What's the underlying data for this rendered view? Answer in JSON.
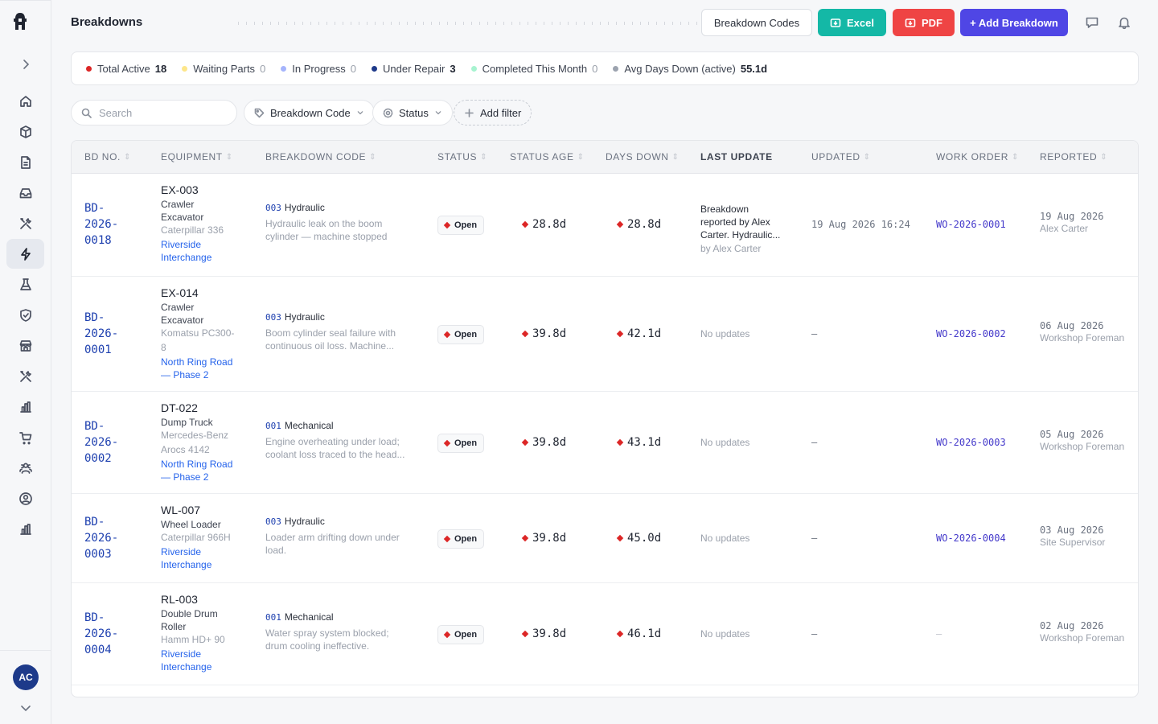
{
  "sidebar": {
    "avatar_initials": "AC",
    "nav": [
      "home-icon",
      "package-icon",
      "file-icon",
      "inbox-icon",
      "tools-icon",
      "bolt-icon",
      "flask-icon",
      "shield-icon",
      "store-icon",
      "tools-icon",
      "bar-chart-icon",
      "cart-icon",
      "users-icon",
      "user-circle-icon",
      "bar-chart-icon"
    ],
    "active_index": 5
  },
  "header": {
    "title": "Breakdowns",
    "codes_label": "Breakdown Codes",
    "excel_label": "Excel",
    "pdf_label": "PDF",
    "add_label": "+ Add Breakdown"
  },
  "stats": [
    {
      "label": "Total Active",
      "value": "18",
      "color": "#dc2626",
      "muted": false
    },
    {
      "label": "Waiting Parts",
      "value": "0",
      "color": "#fde68a",
      "muted": true
    },
    {
      "label": "In Progress",
      "value": "0",
      "color": "#a5b4fc",
      "muted": true
    },
    {
      "label": "Under Repair",
      "value": "3",
      "color": "#1e3a8a",
      "muted": false
    },
    {
      "label": "Completed This Month",
      "value": "0",
      "color": "#a7f3d0",
      "muted": true
    },
    {
      "label": "Avg Days Down (active)",
      "value": "55.1d",
      "color": "#9ca3af",
      "muted": false
    }
  ],
  "filters": {
    "search_placeholder": "Search",
    "code_label": "Breakdown Code",
    "status_label": "Status",
    "add_filter_label": "Add filter"
  },
  "columns": {
    "bd_no": "BD NO.",
    "equipment": "EQUIPMENT",
    "code": "BREAKDOWN CODE",
    "status": "STATUS",
    "status_age": "STATUS AGE",
    "days_down": "DAYS DOWN",
    "last_update": "LAST UPDATE",
    "updated": "UPDATED",
    "work_order": "WORK ORDER",
    "reported": "REPORTED"
  },
  "rows": [
    {
      "bd_lines": [
        "BD-",
        "2026-",
        "0018"
      ],
      "eq_code": "EX-003",
      "eq_type": [
        "Crawler",
        "Excavator"
      ],
      "eq_model": [
        "Caterpillar 336"
      ],
      "eq_loc": [
        "Riverside",
        "Interchange"
      ],
      "code_num": "003",
      "code_name": "Hydraulic",
      "code_desc": [
        "Hydraulic leak on the boom",
        "cylinder — machine stopped"
      ],
      "status": "Open",
      "age": "28.8d",
      "days": "28.8d",
      "last_update": [
        "Breakdown",
        "reported by Alex",
        "Carter. Hydraulic..."
      ],
      "last_update_by": "by Alex Carter",
      "updated": "19 Aug 2026 16:24",
      "work_order": "WO-2026-0001",
      "reported_date": "19 Aug 2026",
      "reported_by": "Alex Carter"
    },
    {
      "bd_lines": [
        "BD-",
        "2026-",
        "0001"
      ],
      "eq_code": "EX-014",
      "eq_type": [
        "Crawler",
        "Excavator"
      ],
      "eq_model": [
        "Komatsu PC300-",
        "8"
      ],
      "eq_loc": [
        "North Ring Road",
        "— Phase 2"
      ],
      "code_num": "003",
      "code_name": "Hydraulic",
      "code_desc": [
        "Boom cylinder seal failure with",
        "continuous oil loss. Machine..."
      ],
      "status": "Open",
      "age": "39.8d",
      "days": "42.1d",
      "last_update": [],
      "last_update_none": "No updates",
      "updated": "—",
      "work_order": "WO-2026-0002",
      "reported_date": "06 Aug 2026",
      "reported_by": "Workshop Foreman"
    },
    {
      "bd_lines": [
        "BD-",
        "2026-",
        "0002"
      ],
      "eq_code": "DT-022",
      "eq_type": [
        "Dump Truck"
      ],
      "eq_model": [
        "Mercedes-Benz",
        "Arocs 4142"
      ],
      "eq_loc": [
        "North Ring Road",
        "— Phase 2"
      ],
      "code_num": "001",
      "code_name": "Mechanical",
      "code_desc": [
        "Engine overheating under load;",
        "coolant loss traced to the head..."
      ],
      "status": "Open",
      "age": "39.8d",
      "days": "43.1d",
      "last_update": [],
      "last_update_none": "No updates",
      "updated": "—",
      "work_order": "WO-2026-0003",
      "reported_date": "05 Aug 2026",
      "reported_by": "Workshop Foreman"
    },
    {
      "bd_lines": [
        "BD-",
        "2026-",
        "0003"
      ],
      "eq_code": "WL-007",
      "eq_type": [
        "Wheel Loader"
      ],
      "eq_model": [
        "Caterpillar 966H"
      ],
      "eq_loc": [
        "Riverside",
        "Interchange"
      ],
      "code_num": "003",
      "code_name": "Hydraulic",
      "code_desc": [
        "Loader arm drifting down under",
        "load."
      ],
      "status": "Open",
      "age": "39.8d",
      "days": "45.0d",
      "last_update": [],
      "last_update_none": "No updates",
      "updated": "—",
      "work_order": "WO-2026-0004",
      "reported_date": "03 Aug 2026",
      "reported_by": "Site Supervisor"
    },
    {
      "bd_lines": [
        "BD-",
        "2026-",
        "0004"
      ],
      "eq_code": "RL-003",
      "eq_type": [
        "Double Drum",
        "Roller"
      ],
      "eq_model": [
        "Hamm HD+ 90"
      ],
      "eq_loc": [
        "Riverside",
        "Interchange"
      ],
      "code_num": "001",
      "code_name": "Mechanical",
      "code_desc": [
        "Water spray system blocked;",
        "drum cooling ineffective."
      ],
      "status": "Open",
      "age": "39.8d",
      "days": "46.1d",
      "last_update": [],
      "last_update_none": "No updates",
      "updated": "—",
      "work_order": "—",
      "reported_date": "02 Aug 2026",
      "reported_by": "Workshop Foreman"
    }
  ]
}
